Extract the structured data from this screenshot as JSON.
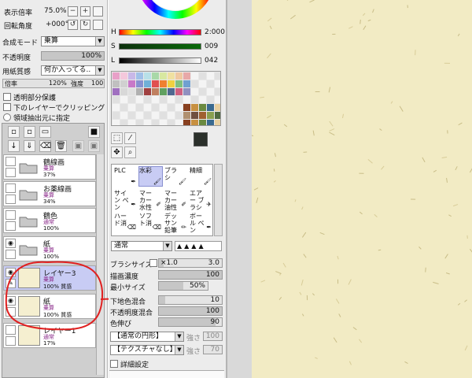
{
  "view": {
    "zoom_label": "表示倍率",
    "zoom_value": "75.0%",
    "rotate_label": "回転角度",
    "rotate_value": "+000°",
    "minus": "−",
    "plus": "+",
    "reset": "↺",
    "reset2": "↻"
  },
  "layer_props": {
    "blend_label": "合成モード",
    "blend_value": "乗算",
    "opacity_label": "不透明度",
    "opacity_value": "100%",
    "opacity_fraction": 1.0,
    "paper_label": "用紙質感",
    "paper_value": "何か入ってる..",
    "scale_label": "倍率",
    "scale_value": "120%",
    "strength_label": "強度",
    "strength_value": "100",
    "preserve_opacity": "透明部分保護",
    "clip_lower": "下のレイヤーでクリッピング",
    "selection_source": "領域抽出元に指定"
  },
  "layers": [
    {
      "name": "鶴線画",
      "mode": "乗算",
      "opacity": "37%",
      "type": "folder",
      "visible": false
    },
    {
      "name": "お薬線画",
      "mode": "乗算",
      "opacity": "34%",
      "type": "folder",
      "visible": false
    },
    {
      "name": "鶴色",
      "mode": "通常",
      "opacity": "100%",
      "type": "folder",
      "visible": false
    },
    {
      "name": "紙",
      "mode": "乗算",
      "opacity": "100%",
      "type": "folder",
      "visible": true
    },
    {
      "name": "レイヤー3",
      "mode": "乗算",
      "opacity": "100% 質感",
      "type": "layer",
      "visible": true,
      "active": true
    },
    {
      "name": "紙",
      "mode": "乗算",
      "opacity": "100% 質感",
      "type": "layer",
      "visible": true
    },
    {
      "name": "レイヤー1",
      "mode": "通常",
      "opacity": "17%",
      "type": "layer",
      "visible": false
    }
  ],
  "color": {
    "h_label": "H",
    "h_value": "2:000",
    "s_label": "S",
    "s_value": "009",
    "l_label": "L",
    "l_value": "042",
    "fg_color": "#2b302b",
    "bg_color": "#7d8d78"
  },
  "brushes": [
    {
      "label": "PLC",
      "icon": "pen-icon"
    },
    {
      "label": "水彩",
      "icon": "brush-icon",
      "selected": true
    },
    {
      "label": "ブラシ",
      "icon": "brush-icon"
    },
    {
      "label": "精細",
      "icon": "brush-icon"
    },
    {
      "label": "サイン ペン",
      "icon": "pen-icon"
    },
    {
      "label": "マーカー 水性",
      "icon": "marker-icon"
    },
    {
      "label": "マーカー 油性",
      "icon": "marker-icon"
    },
    {
      "label": "エアー ブラシ",
      "icon": "airbrush-icon"
    },
    {
      "label": "ハード消",
      "icon": "eraser-icon"
    },
    {
      "label": "ソフト消",
      "icon": "eraser-icon"
    },
    {
      "label": "デッサン 鉛筆",
      "icon": "pencil-icon"
    },
    {
      "label": "ボール ペン",
      "icon": "pen-icon"
    }
  ],
  "brush_params": {
    "mode_value": "通常",
    "size_label": "ブラシサイズ",
    "size_mult": "×1.0",
    "size_value": "3.0",
    "density_label": "描画濃度",
    "density_value": "100",
    "density_fraction": 1.0,
    "min_size_label": "最小サイズ",
    "min_size_value": "50%",
    "min_size_fraction": 0.5,
    "blend_label": "下地色混合",
    "blend_value": "10",
    "blend_fraction": 0.1,
    "opblend_label": "不透明度混合",
    "opblend_value": "100",
    "opblend_fraction": 1.0,
    "colorext_label": "色伸び",
    "colorext_value": "90",
    "colorext_fraction": 0.9,
    "shape_value": "【通常の円形】",
    "shape_strength_label": "強さ",
    "shape_strength_value": "100",
    "texture_value": "【テクスチャなし】",
    "texture_strength_label": "強さ",
    "texture_strength_value": "70",
    "detail_label": "詳細設定"
  },
  "swatch_colors": [
    "#e8a0c8",
    "#f4c8dc",
    "#c8b8e8",
    "#a0c0e8",
    "#b8e0e8",
    "#a8d8a8",
    "#d8e8a0",
    "#f0e0a0",
    "#f0c8a0",
    "#e8a8a8",
    "#c0c0c0",
    "#d0d0d0",
    "#c878c8",
    "#8890d0",
    "#70b0d8",
    "#e05050",
    "#f08030",
    "#f0d040",
    "#80c080",
    "#70a0d0",
    "#a070c0",
    "#d8d8d8",
    "#e0e0e0",
    "#b0b0b0",
    "#a04040",
    "#c08060",
    "#60a060",
    "#506890",
    "#d06080",
    "#9090c0"
  ],
  "palette_tail": [
    "#884020",
    "#c89040",
    "#6a8a40",
    "#3a6a90",
    "#e8d0a0",
    "#b09070",
    "#705040",
    "#a06030",
    "#8aa050",
    "#506a40"
  ]
}
